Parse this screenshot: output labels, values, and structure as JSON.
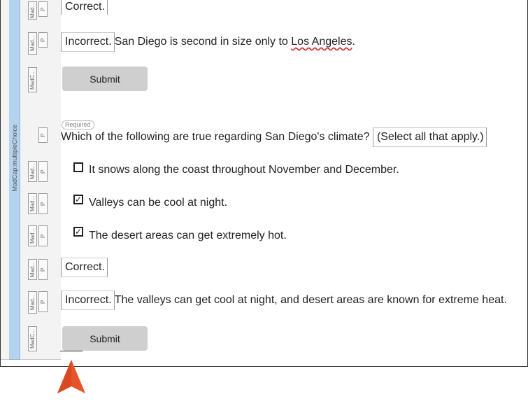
{
  "gutter": {
    "label": "MadCap:multipleChoice",
    "tag_madcap": "Mad...",
    "tag_madcap_c": "MadC...",
    "tag_p": "P"
  },
  "lines": {
    "correct_1": "Correct.",
    "incorrect_1_label": "Incorrect.",
    "incorrect_1_text_a": "San Diego is second in size only to ",
    "incorrect_1_link": "Los Angeles",
    "incorrect_1_text_b": ".",
    "submit_1": "Submit",
    "required": "Required",
    "question": "Which of the following are true regarding San Diego's climate?",
    "question_hint": "(Select all that apply.)",
    "option_1": "It snows along the coast throughout November and December.",
    "option_2": "Valleys can be cool at night.",
    "option_3": "The desert areas can get extremely hot.",
    "correct_2": "Correct.",
    "incorrect_2_label": "Incorrect.",
    "incorrect_2_text": "The valleys can get cool at night, and desert areas are known for extreme heat.",
    "submit_2": "Submit"
  },
  "options_checked": [
    false,
    true,
    true
  ],
  "colors": {
    "accent_pointer": "#e8542a",
    "gutter_blue": "#b5d3ee",
    "button_bg": "#cfcfcf"
  }
}
